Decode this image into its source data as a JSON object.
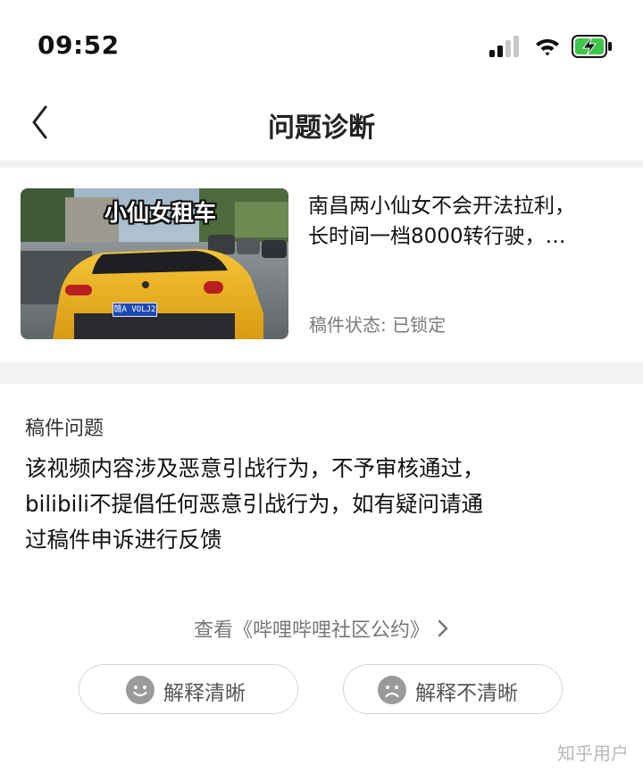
{
  "status_bar": {
    "time": "09:52",
    "icons": [
      "cellular-signal-icon",
      "wifi-icon",
      "battery-charging-icon"
    ]
  },
  "nav": {
    "title": "问题诊断",
    "back_icon": "chevron-left-icon"
  },
  "manuscript": {
    "thumbnail_caption": "小仙女租车",
    "thumbnail_plate": "赣A VOLJ2",
    "title_line1": "南昌两小仙女不会开法拉利，",
    "title_line2": "长时间一档8000转行驶，…",
    "status": "稿件状态: 已锁定"
  },
  "problem": {
    "label": "稿件问题",
    "line1": "该视频内容涉及恶意引战行为，不予审核通过，",
    "line2": "bilibili不提倡任何恶意引战行为，如有疑问请通",
    "line3": "过稿件申诉进行反馈"
  },
  "convention_link": {
    "label": "查看《哔哩哔哩社区公约》",
    "icon": "chevron-right-icon"
  },
  "feedback": {
    "clear_label": "解释清晰",
    "clear_icon": "smile-face-icon",
    "unclear_label": "解释不清晰",
    "unclear_icon": "sad-face-icon"
  },
  "watermark": "知乎用户",
  "colors": {
    "background": "#ffffff",
    "band": "#f3f3f5",
    "text_primary": "#111111",
    "text_secondary": "#7a7a7a",
    "thumbnail_car": "#f2b01b",
    "plate": "#1c49b3"
  }
}
